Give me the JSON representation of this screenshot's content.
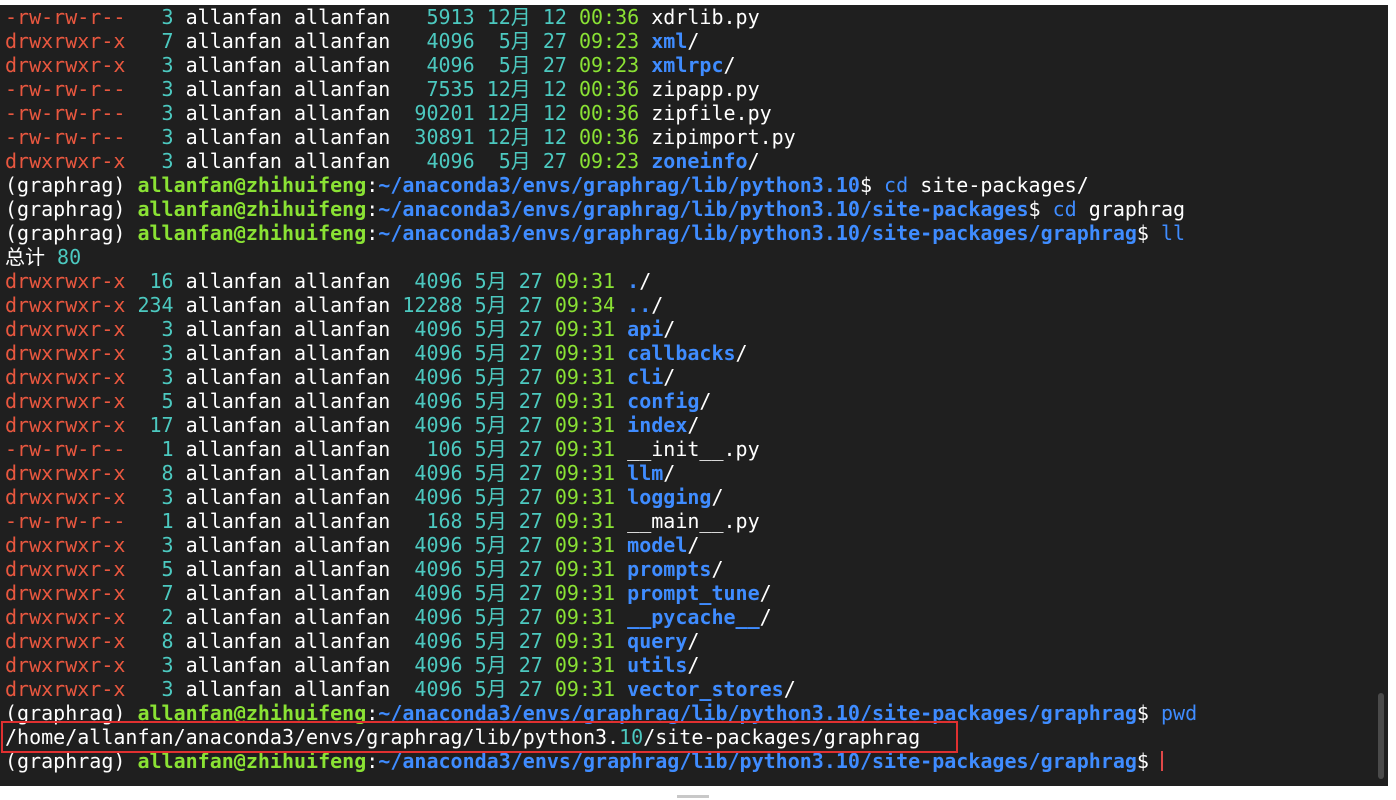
{
  "listing_top": [
    {
      "perm": "-rw-rw-r--",
      "links": "  3",
      "owner": "allanfan",
      "group": "allanfan",
      "size": "  5913",
      "month": "12月",
      "day": "12",
      "time": "00:36",
      "name": "xdrlib.py",
      "is_dir": false
    },
    {
      "perm": "drwxrwxr-x",
      "links": "  7",
      "owner": "allanfan",
      "group": "allanfan",
      "size": "  4096",
      "month": " 5月",
      "day": "27",
      "time": "09:23",
      "name": "xml",
      "is_dir": true
    },
    {
      "perm": "drwxrwxr-x",
      "links": "  3",
      "owner": "allanfan",
      "group": "allanfan",
      "size": "  4096",
      "month": " 5月",
      "day": "27",
      "time": "09:23",
      "name": "xmlrpc",
      "is_dir": true
    },
    {
      "perm": "-rw-rw-r--",
      "links": "  3",
      "owner": "allanfan",
      "group": "allanfan",
      "size": "  7535",
      "month": "12月",
      "day": "12",
      "time": "00:36",
      "name": "zipapp.py",
      "is_dir": false
    },
    {
      "perm": "-rw-rw-r--",
      "links": "  3",
      "owner": "allanfan",
      "group": "allanfan",
      "size": " 90201",
      "month": "12月",
      "day": "12",
      "time": "00:36",
      "name": "zipfile.py",
      "is_dir": false
    },
    {
      "perm": "-rw-rw-r--",
      "links": "  3",
      "owner": "allanfan",
      "group": "allanfan",
      "size": " 30891",
      "month": "12月",
      "day": "12",
      "time": "00:36",
      "name": "zipimport.py",
      "is_dir": false
    },
    {
      "perm": "drwxrwxr-x",
      "links": "  3",
      "owner": "allanfan",
      "group": "allanfan",
      "size": "  4096",
      "month": " 5月",
      "day": "27",
      "time": "09:23",
      "name": "zoneinfo",
      "is_dir": true
    }
  ],
  "prompt": {
    "env": "(graphrag)",
    "user_host": "allanfan@zhihuifeng",
    "sep": ":",
    "dollar": "$"
  },
  "prompt_cd_site": {
    "path_pre": "~/anaconda3/envs/graphrag/lib/python3.",
    "path_ver": "10",
    "path_post": "",
    "cmd": "cd",
    "arg": "site-packages/"
  },
  "prompt_cd_graphrag": {
    "path_pre": "~/anaconda3/envs/graphrag/lib/python3.",
    "path_ver": "10",
    "path_post": "/site-packages",
    "cmd": "cd",
    "arg": "graphrag"
  },
  "prompt_ll": {
    "path_pre": "~/anaconda3/envs/graphrag/lib/python3.",
    "path_ver": "10",
    "path_post": "/site-packages/graphrag",
    "cmd": "ll",
    "arg": ""
  },
  "total": {
    "label": "总计",
    "value": "80"
  },
  "listing_graphrag": [
    {
      "perm": "drwxrwxr-x",
      "links": " 16",
      "owner": "allanfan",
      "group": "allanfan",
      "size": " 4096",
      "month": "5月",
      "day": "27",
      "time": "09:31",
      "name": ".",
      "is_dir": true
    },
    {
      "perm": "drwxrwxr-x",
      "links": "234",
      "owner": "allanfan",
      "group": "allanfan",
      "size": "12288",
      "month": "5月",
      "day": "27",
      "time": "09:34",
      "name": "..",
      "is_dir": true
    },
    {
      "perm": "drwxrwxr-x",
      "links": "  3",
      "owner": "allanfan",
      "group": "allanfan",
      "size": " 4096",
      "month": "5月",
      "day": "27",
      "time": "09:31",
      "name": "api",
      "is_dir": true
    },
    {
      "perm": "drwxrwxr-x",
      "links": "  3",
      "owner": "allanfan",
      "group": "allanfan",
      "size": " 4096",
      "month": "5月",
      "day": "27",
      "time": "09:31",
      "name": "callbacks",
      "is_dir": true
    },
    {
      "perm": "drwxrwxr-x",
      "links": "  3",
      "owner": "allanfan",
      "group": "allanfan",
      "size": " 4096",
      "month": "5月",
      "day": "27",
      "time": "09:31",
      "name": "cli",
      "is_dir": true
    },
    {
      "perm": "drwxrwxr-x",
      "links": "  5",
      "owner": "allanfan",
      "group": "allanfan",
      "size": " 4096",
      "month": "5月",
      "day": "27",
      "time": "09:31",
      "name": "config",
      "is_dir": true
    },
    {
      "perm": "drwxrwxr-x",
      "links": " 17",
      "owner": "allanfan",
      "group": "allanfan",
      "size": " 4096",
      "month": "5月",
      "day": "27",
      "time": "09:31",
      "name": "index",
      "is_dir": true
    },
    {
      "perm": "-rw-rw-r--",
      "links": "  1",
      "owner": "allanfan",
      "group": "allanfan",
      "size": "  106",
      "month": "5月",
      "day": "27",
      "time": "09:31",
      "name": "__init__.py",
      "is_dir": false
    },
    {
      "perm": "drwxrwxr-x",
      "links": "  8",
      "owner": "allanfan",
      "group": "allanfan",
      "size": " 4096",
      "month": "5月",
      "day": "27",
      "time": "09:31",
      "name": "llm",
      "is_dir": true
    },
    {
      "perm": "drwxrwxr-x",
      "links": "  3",
      "owner": "allanfan",
      "group": "allanfan",
      "size": " 4096",
      "month": "5月",
      "day": "27",
      "time": "09:31",
      "name": "logging",
      "is_dir": true
    },
    {
      "perm": "-rw-rw-r--",
      "links": "  1",
      "owner": "allanfan",
      "group": "allanfan",
      "size": "  168",
      "month": "5月",
      "day": "27",
      "time": "09:31",
      "name": "__main__.py",
      "is_dir": false
    },
    {
      "perm": "drwxrwxr-x",
      "links": "  3",
      "owner": "allanfan",
      "group": "allanfan",
      "size": " 4096",
      "month": "5月",
      "day": "27",
      "time": "09:31",
      "name": "model",
      "is_dir": true
    },
    {
      "perm": "drwxrwxr-x",
      "links": "  5",
      "owner": "allanfan",
      "group": "allanfan",
      "size": " 4096",
      "month": "5月",
      "day": "27",
      "time": "09:31",
      "name": "prompts",
      "is_dir": true
    },
    {
      "perm": "drwxrwxr-x",
      "links": "  7",
      "owner": "allanfan",
      "group": "allanfan",
      "size": " 4096",
      "month": "5月",
      "day": "27",
      "time": "09:31",
      "name": "prompt_tune",
      "is_dir": true
    },
    {
      "perm": "drwxrwxr-x",
      "links": "  2",
      "owner": "allanfan",
      "group": "allanfan",
      "size": " 4096",
      "month": "5月",
      "day": "27",
      "time": "09:31",
      "name": "__pycache__",
      "is_dir": true
    },
    {
      "perm": "drwxrwxr-x",
      "links": "  8",
      "owner": "allanfan",
      "group": "allanfan",
      "size": " 4096",
      "month": "5月",
      "day": "27",
      "time": "09:31",
      "name": "query",
      "is_dir": true
    },
    {
      "perm": "drwxrwxr-x",
      "links": "  3",
      "owner": "allanfan",
      "group": "allanfan",
      "size": " 4096",
      "month": "5月",
      "day": "27",
      "time": "09:31",
      "name": "utils",
      "is_dir": true
    },
    {
      "perm": "drwxrwxr-x",
      "links": "  3",
      "owner": "allanfan",
      "group": "allanfan",
      "size": " 4096",
      "month": "5月",
      "day": "27",
      "time": "09:31",
      "name": "vector_stores",
      "is_dir": true
    }
  ],
  "prompt_pwd": {
    "path_pre": "~/anaconda3/envs/graphrag/lib/python3.",
    "path_ver": "10",
    "path_post": "/site-packages/graphrag",
    "cmd": "pwd",
    "arg": ""
  },
  "pwd_output": {
    "pre": "/home/allanfan/anaconda3/envs/graphrag/lib/python3.",
    "ver": "10",
    "post": "/site-packages/graphrag"
  },
  "prompt_final": {
    "path_pre": "~/anaconda3/envs/graphrag/lib/python3.",
    "path_ver": "10",
    "path_post": "/site-packages/graphrag",
    "cmd": "",
    "arg": ""
  },
  "colors": {
    "background": "#1f1f1f",
    "permissions": "#e9573f",
    "numbers": "#4cc9c0",
    "time": "#8ae234",
    "directory": "#3f8cff",
    "highlight_box": "#e03030"
  }
}
